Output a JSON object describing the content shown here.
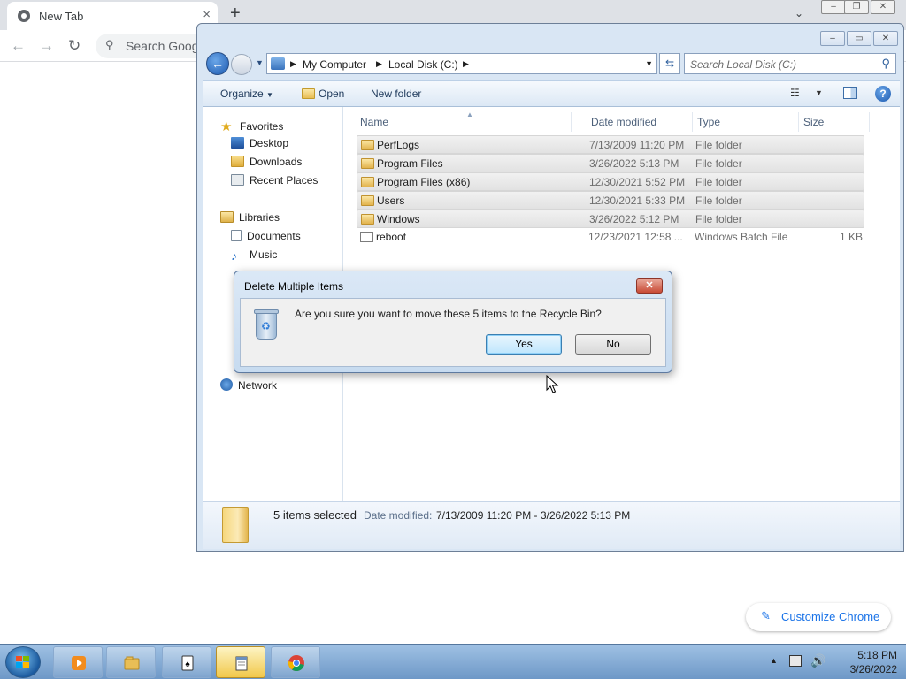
{
  "chrome": {
    "tab_title": "New Tab",
    "tab_close": "×",
    "new_tab": "+",
    "tab_menu": "⌄",
    "back": "←",
    "forward": "→",
    "reload": "↻",
    "search_placeholder": "Search Goog",
    "customize_label": "Customize Chrome"
  },
  "explorer": {
    "address": {
      "crumbs": [
        "My Computer",
        "Local Disk (C:)"
      ]
    },
    "search_placeholder": "Search Local Disk (C:)",
    "commands": {
      "organize": "Organize",
      "open": "Open",
      "new_folder": "New folder"
    },
    "nav": {
      "favorites": "Favorites",
      "desktop": "Desktop",
      "downloads": "Downloads",
      "recent_places": "Recent Places",
      "libraries": "Libraries",
      "documents": "Documents",
      "music": "Music",
      "network": "Network"
    },
    "columns": {
      "name": "Name",
      "date_modified": "Date modified",
      "type": "Type",
      "size": "Size"
    },
    "files": [
      {
        "name": "PerfLogs",
        "date": "7/13/2009 11:20 PM",
        "type": "File folder",
        "size": "",
        "selected": true
      },
      {
        "name": "Program Files",
        "date": "3/26/2022 5:13 PM",
        "type": "File folder",
        "size": "",
        "selected": true
      },
      {
        "name": "Program Files (x86)",
        "date": "12/30/2021 5:52 PM",
        "type": "File folder",
        "size": "",
        "selected": true
      },
      {
        "name": "Users",
        "date": "12/30/2021 5:33 PM",
        "type": "File folder",
        "size": "",
        "selected": true
      },
      {
        "name": "Windows",
        "date": "3/26/2022 5:12 PM",
        "type": "File folder",
        "size": "",
        "selected": true
      },
      {
        "name": "reboot",
        "date": "12/23/2021 12:58 ...",
        "type": "Windows Batch File",
        "size": "1 KB",
        "selected": false
      }
    ],
    "details": {
      "selected": "5 items selected",
      "date_label": "Date modified:",
      "date_value": "7/13/2009 11:20 PM - 3/26/2022 5:13 PM"
    }
  },
  "dialog": {
    "title": "Delete Multiple Items",
    "close": "✕",
    "message": "Are you sure you want to move these 5 items to the Recycle Bin?",
    "yes": "Yes",
    "no": "No"
  },
  "taskbar": {
    "time": "5:18 PM",
    "date": "3/26/2022"
  },
  "colors": {
    "explorer_frame": "#d9e6f4",
    "selection": "#e2e2e2",
    "chrome_accent": "#1a73e8",
    "taskbar": "#6e98c7"
  }
}
